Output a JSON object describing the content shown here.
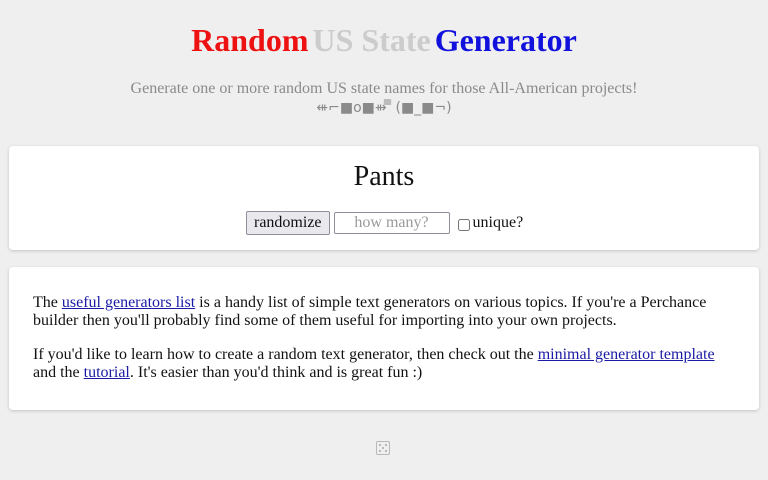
{
  "header": {
    "title_word_1": "Random",
    "title_word_2": "US State",
    "title_word_3": "Generator",
    "colors": {
      "word_1": "#ee1111",
      "word_2": "#cccccc",
      "word_3": "#1111dd"
    },
    "subtitle": "Generate one or more random US state names for those All-American projects!",
    "emoticon": "⇺⌐■o■⇻ ̿̿ (■_■¬)"
  },
  "generator": {
    "output": "Pants",
    "randomize_label": "randomize",
    "count_placeholder": "how many?",
    "unique_label": "unique?",
    "unique_checked": false
  },
  "info": {
    "p1_start": "The ",
    "p1_link": "useful generators list",
    "p1_end": " is a handy list of simple text generators on various topics. If you're a Perchance builder then you'll probably find some of them useful for importing into your own projects.",
    "p2_start": "If you'd like to learn how to create a random text generator, then check out the ",
    "p2_link1": "minimal generator template",
    "p2_mid": " and the ",
    "p2_link2": "tutorial",
    "p2_end": ". It's easier than you'd think and is great fun :)"
  },
  "footer": {
    "icon": "dice-icon"
  }
}
